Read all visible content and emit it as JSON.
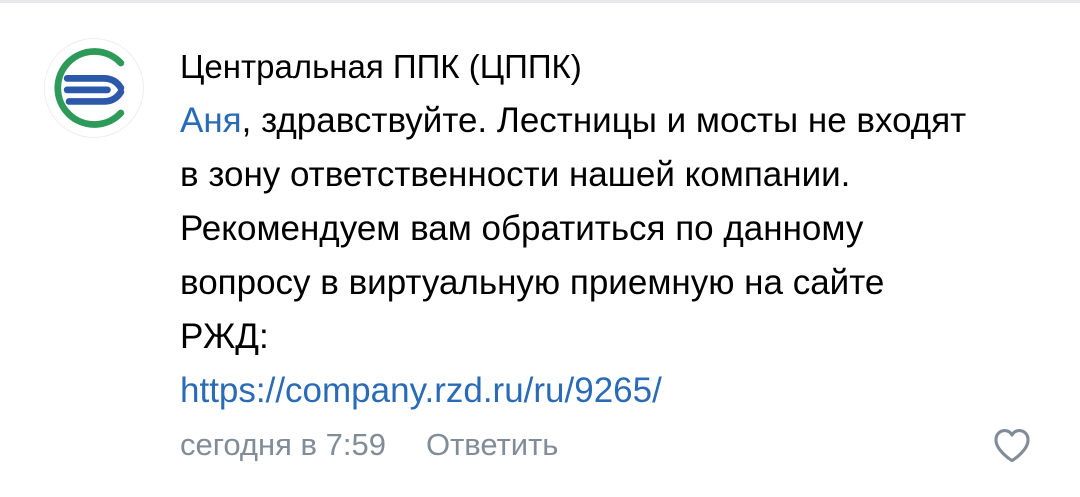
{
  "comment": {
    "author": "Центральная ППК (ЦППК)",
    "mention": "Аня",
    "text": ", здравствуйте. Лестницы и мосты не входят в зону ответственности нашей компании. Рекомендуем вам обратиться по данному вопросу в виртуальную приемную на сайте РЖД:",
    "link": "https://company.rzd.ru/ru/9265/",
    "timestamp": "сегодня в 7:59",
    "reply_label": "Ответить",
    "avatar_icon": "cppk-logo-icon",
    "like_icon": "heart-icon"
  },
  "colors": {
    "link": "#2a6bb8",
    "meta": "#818c99",
    "logo_green": "#2e9a5a",
    "logo_blue": "#2b58a8"
  }
}
